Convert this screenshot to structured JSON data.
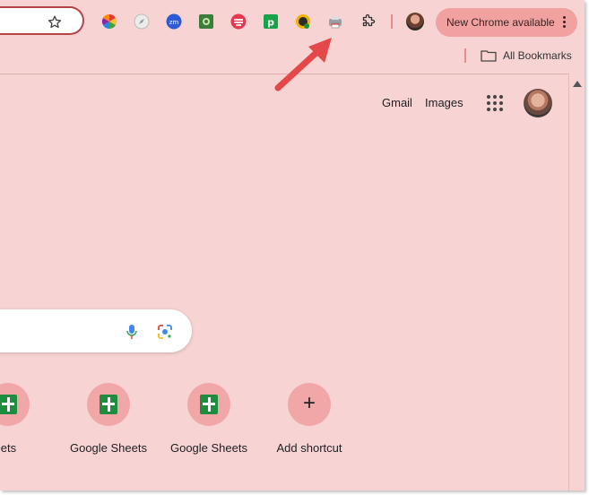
{
  "browser": {
    "update_label": "New Chrome available",
    "extensions": [
      "color-wheel-icon",
      "compass-icon",
      "zoom-icon",
      "image-capture-icon",
      "cast-like-icon",
      "green-p-icon",
      "pixel-ruler-icon",
      "printer-icon",
      "puzzle-icon"
    ],
    "bookmarks": {
      "all_bookmarks_label": "All Bookmarks"
    }
  },
  "page": {
    "header_links": {
      "gmail": "Gmail",
      "images": "Images"
    },
    "shortcuts": [
      {
        "label": "le Sheets"
      },
      {
        "label": "Google Sheets"
      },
      {
        "label": "Google Sheets"
      },
      {
        "label": "Add shortcut"
      }
    ]
  },
  "colors": {
    "page_background": "#f8d3d3",
    "update_button": "#f2a1a1",
    "annotation_arrow": "#e54848",
    "sheets_green": "#1e8e3e"
  }
}
